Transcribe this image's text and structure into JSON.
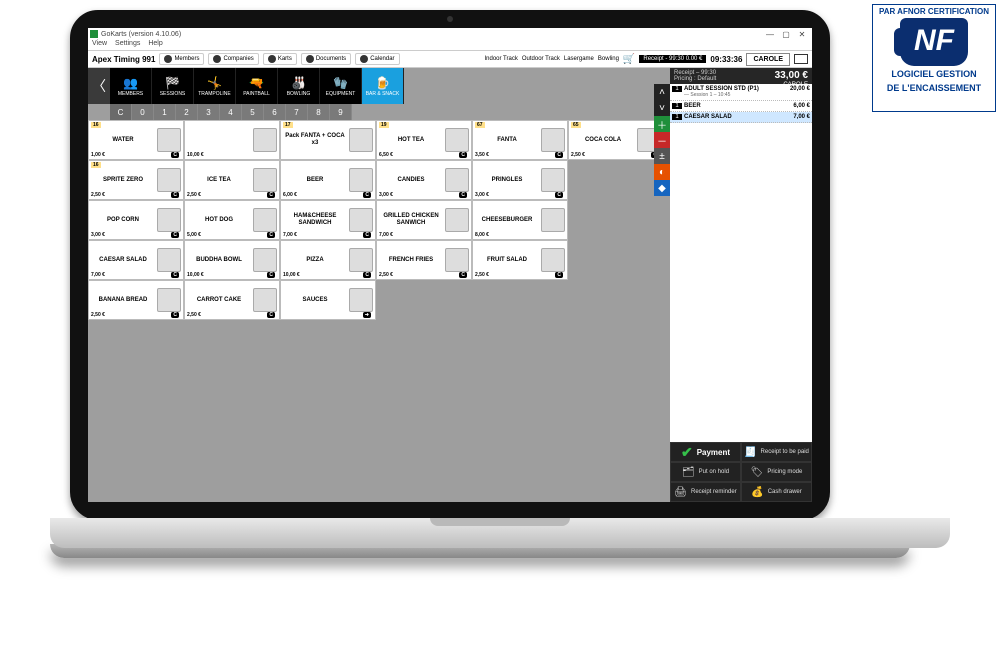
{
  "window": {
    "app": "GoKarts (version 4.10.06)",
    "menus": [
      "View",
      "Settings",
      "Help"
    ],
    "min": "—",
    "max": "▢",
    "close": "✕"
  },
  "toolbar": {
    "title": "Apex Timing 991",
    "buttons": [
      {
        "label": "Members"
      },
      {
        "label": "Companies"
      },
      {
        "label": "Karts"
      },
      {
        "label": "Documents"
      },
      {
        "label": "Calendar"
      }
    ],
    "tracks": [
      "Indoor Track",
      "Outdoor Track",
      "Lasergame",
      "Bowling"
    ],
    "receipt_chip": "Receipt - 99:30\n0.00 €",
    "time": "09:33:36",
    "operator": "CAROLE"
  },
  "categories": [
    {
      "icon": "👥",
      "label": "MEMBERS"
    },
    {
      "icon": "🏁",
      "label": "SESSIONS"
    },
    {
      "icon": "🤸",
      "label": "TRAMPOLINE"
    },
    {
      "icon": "🔫",
      "label": "PAINTBALL"
    },
    {
      "icon": "🎳",
      "label": "BOWLING"
    },
    {
      "icon": "🧤",
      "label": "EQUIPMENT"
    },
    {
      "icon": "🍺",
      "label": "BAR & SNACK",
      "active": true
    }
  ],
  "numbers": [
    "C",
    "0",
    "1",
    "2",
    "3",
    "4",
    "5",
    "6",
    "7",
    "8",
    "9"
  ],
  "members_label": "Members",
  "products": [
    [
      {
        "idx": "16",
        "name": "WATER",
        "price": "1,00 €",
        "stock": "C"
      },
      {
        "idx": "",
        "name": "",
        "price": "10,00 €",
        "stock": "",
        "half": true
      },
      {
        "idx": "17",
        "name": "Pack FANTA + COCA x3",
        "price": "",
        "stock": ""
      },
      {
        "idx": "19",
        "name": "HOT TEA",
        "price": "6,50 €",
        "stock": "C"
      },
      {
        "idx": "67",
        "name": "FANTA",
        "price": "3,50 €",
        "stock": "C"
      },
      {
        "idx": "65",
        "name": "COCA COLA",
        "price": "2,50 €",
        "stock": "C"
      }
    ],
    [
      {
        "idx": "16",
        "name": "SPRITE ZERO",
        "price": "2,50 €",
        "stock": "C"
      },
      {
        "idx": "",
        "name": "ICE TEA",
        "price": "2,50 €",
        "stock": "C"
      },
      {
        "idx": "",
        "name": "BEER",
        "price": "6,00 €",
        "stock": "C"
      },
      {
        "idx": "",
        "name": "CANDIES",
        "price": "3,00 €",
        "stock": "C"
      },
      {
        "idx": "",
        "name": "PRINGLES",
        "price": "3,00 €",
        "stock": "C"
      },
      {
        "empty": true
      }
    ],
    [
      {
        "idx": "",
        "name": "POP CORN",
        "price": "3,00 €",
        "stock": "C"
      },
      {
        "idx": "",
        "name": "HOT DOG",
        "price": "5,00 €",
        "stock": "C"
      },
      {
        "idx": "",
        "name": "HAM&CHEESE SANDWICH",
        "price": "7,00 €",
        "stock": "C"
      },
      {
        "idx": "",
        "name": "GRILLED CHICKEN SANWICH",
        "price": "7,00 €",
        "stock": ""
      },
      {
        "idx": "",
        "name": "CHEESEBURGER",
        "price": "8,00 €",
        "stock": ""
      },
      {
        "empty": true
      }
    ],
    [
      {
        "idx": "",
        "name": "CAESAR SALAD",
        "price": "7,00 €",
        "stock": "C"
      },
      {
        "idx": "",
        "name": "BUDDHA BOWL",
        "price": "10,00 €",
        "stock": "C"
      },
      {
        "idx": "",
        "name": "PIZZA",
        "price": "10,00 €",
        "stock": "C"
      },
      {
        "idx": "",
        "name": "FRENCH FRIES",
        "price": "2,50 €",
        "stock": "C"
      },
      {
        "idx": "",
        "name": "FRUIT SALAD",
        "price": "2,50 €",
        "stock": "C"
      },
      {
        "empty": true
      }
    ],
    [
      {
        "idx": "",
        "name": "BANANA BREAD",
        "price": "2,50 €",
        "stock": "C"
      },
      {
        "idx": "",
        "name": "CARROT CAKE",
        "price": "2,50 €",
        "stock": "C"
      },
      {
        "idx": "",
        "name": "SAUCES",
        "price": "",
        "stock": "➜"
      },
      {
        "empty": true
      },
      {
        "empty": true
      },
      {
        "empty": true
      }
    ]
  ],
  "receipt": {
    "header_line1": "Receipt – 99:30",
    "header_line2": "Pricing : Default",
    "operator": "CAROLE",
    "total": "33,00 €",
    "lines": [
      {
        "qty": "1",
        "label": "ADULT SESSION STD (P1)",
        "sub": "— Session 1 – 10:45",
        "amt": "20,00 €"
      },
      {
        "qty": "1",
        "label": "BEER",
        "amt": "6,00 €"
      },
      {
        "qty": "1",
        "label": "CAESAR SALAD",
        "amt": "7,00 €",
        "selected": true
      }
    ]
  },
  "actions": {
    "payment": "Payment",
    "receipt_to_paid": "Receipt to be paid",
    "put_on_hold": "Put on hold",
    "pricing_mode": "Pricing mode",
    "receipt_reminder": "Receipt reminder",
    "cash_drawer": "Cash drawer"
  },
  "nf": {
    "arc": "PAR AFNOR CERTIFICATION",
    "logo": "NF",
    "line1": "LOGICIEL GESTION",
    "line2": "DE L'ENCAISSEMENT"
  }
}
